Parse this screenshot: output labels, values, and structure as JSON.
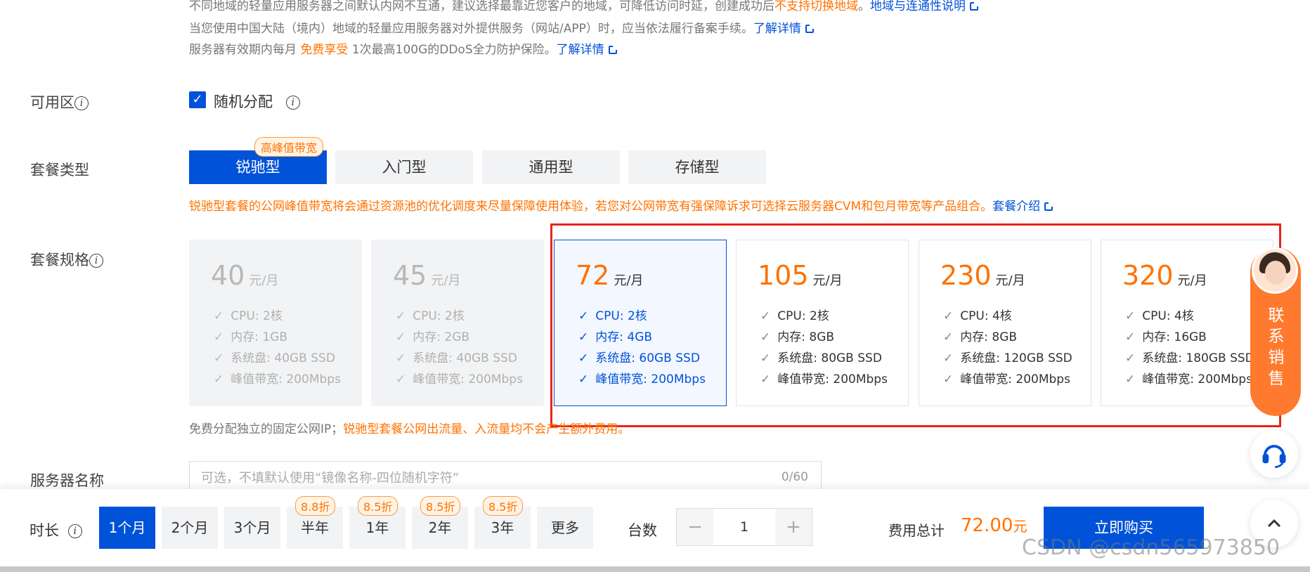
{
  "notices": {
    "line1": "不同地域的轻量应用服务器之间默认内网不互通，建议选择最靠近您客户的地域，可降低访问时延，创建成功后",
    "line1_orange": "不支持切换地域",
    "line1_link": "地域与连通性说明",
    "line2": "当您使用中国大陆（境内）地域的轻量应用服务器对外提供服务（网站/APP）时，应当依法履行备案手续。",
    "line2_link": "了解详情",
    "line3_prefix": "服务器有效期内每月",
    "line3_orange": "免费享受",
    "line3_suffix": "1次最高100G的DDoS全力防护保险。",
    "line3_link": "了解详情"
  },
  "availability_zone": {
    "label": "可用区",
    "checkbox_label": "随机分配",
    "checked": true
  },
  "package_type": {
    "label": "套餐类型",
    "badge": "高峰值带宽",
    "tabs": [
      "锐驰型",
      "入门型",
      "通用型",
      "存储型"
    ],
    "active": "锐驰型",
    "desc": "锐驰型套餐的公网峰值带宽将会通过资源池的优化调度来尽量保障使用体验，若您对公网带宽有强保障诉求可选择云服务器CVM和包月带宽等产品组合。",
    "desc_link": "套餐介绍"
  },
  "package_spec": {
    "label": "套餐规格",
    "unit": "元/月",
    "cards": [
      {
        "price": "40",
        "state": "disabled",
        "specs": [
          "CPU: 2核",
          "内存: 1GB",
          "系统盘: 40GB SSD",
          "峰值带宽: 200Mbps"
        ]
      },
      {
        "price": "45",
        "state": "disabled",
        "specs": [
          "CPU: 2核",
          "内存: 2GB",
          "系统盘: 40GB SSD",
          "峰值带宽: 200Mbps"
        ]
      },
      {
        "price": "72",
        "state": "selected",
        "specs": [
          "CPU: 2核",
          "内存: 4GB",
          "系统盘: 60GB SSD",
          "峰值带宽: 200Mbps"
        ]
      },
      {
        "price": "105",
        "state": "normal",
        "specs": [
          "CPU: 2核",
          "内存: 8GB",
          "系统盘: 80GB SSD",
          "峰值带宽: 200Mbps"
        ]
      },
      {
        "price": "230",
        "state": "normal",
        "specs": [
          "CPU: 4核",
          "内存: 8GB",
          "系统盘: 120GB SSD",
          "峰值带宽: 200Mbps"
        ]
      },
      {
        "price": "320",
        "state": "normal",
        "specs": [
          "CPU: 4核",
          "内存: 16GB",
          "系统盘: 180GB SSD",
          "峰值带宽: 200Mbps"
        ]
      }
    ],
    "ip_note_prefix": "免费分配独立的固定公网IP；",
    "ip_note_orange": "锐驰型套餐公网出流量、入流量均不会产生额外费用。"
  },
  "server_name": {
    "label": "服务器名称",
    "placeholder": "可选，不填默认使用“镜像名称-四位随机字符”",
    "counter": "0/60"
  },
  "bottom_bar": {
    "duration_label": "时长",
    "durations": [
      {
        "label": "1个月",
        "discount": ""
      },
      {
        "label": "2个月",
        "discount": ""
      },
      {
        "label": "3个月",
        "discount": ""
      },
      {
        "label": "半年",
        "discount": "8.8折"
      },
      {
        "label": "1年",
        "discount": "8.5折"
      },
      {
        "label": "2年",
        "discount": "8.5折"
      },
      {
        "label": "3年",
        "discount": "8.5折"
      },
      {
        "label": "更多",
        "discount": ""
      }
    ],
    "active_duration": "1个月",
    "count_label": "台数",
    "count_value": "1",
    "minus": "−",
    "plus": "+",
    "total_label": "费用总计",
    "total_amount": "72.00",
    "total_unit": "元",
    "buy_label": "立即购买"
  },
  "side_widget": {
    "contact_text": "联系销售",
    "headset_icon": "headset-icon",
    "up_icon": "chevron-up-icon"
  },
  "watermark": "CSDN @csdn565973850",
  "colors": {
    "primary": "#0052d9",
    "orange": "#ff7200",
    "highlight_box": "#e8231b"
  }
}
